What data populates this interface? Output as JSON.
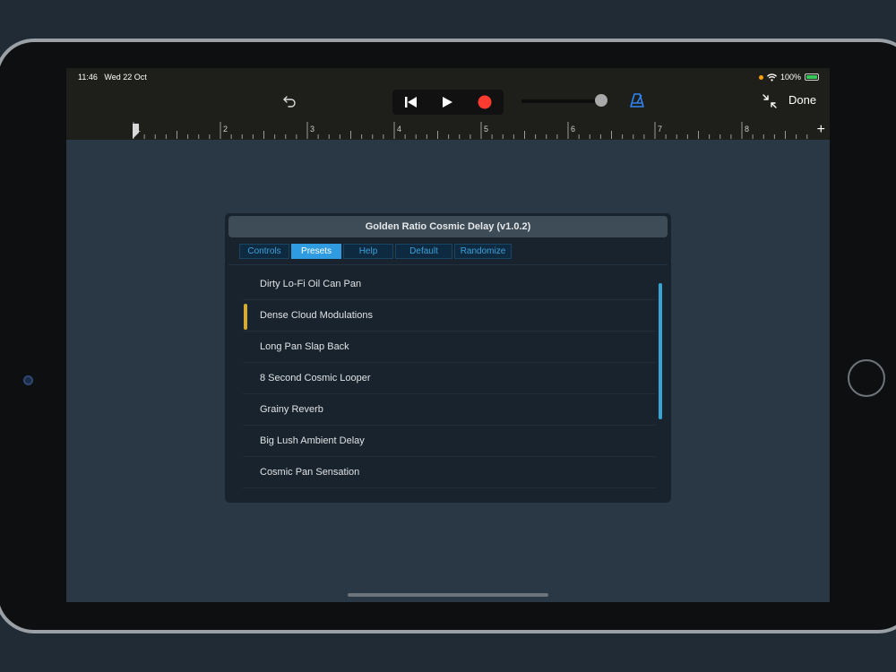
{
  "status_bar": {
    "time": "11:46",
    "date": "Wed 22 Oct",
    "battery": "100%"
  },
  "toolbar": {
    "done_label": "Done",
    "transport_icons": [
      "skip-back-icon",
      "play-icon",
      "record-icon"
    ],
    "record_color": "#ff3b30",
    "metronome_color": "#2f86f6"
  },
  "ruler": {
    "bars": [
      "1",
      "2",
      "3",
      "4",
      "5",
      "6",
      "7",
      "8"
    ],
    "add_label": "+"
  },
  "plugin": {
    "title": "Golden Ratio Cosmic Delay (v1.0.2)",
    "tabs": [
      "Controls",
      "Presets",
      "Help",
      "Default",
      "Randomize"
    ],
    "active_tab": "Presets",
    "presets": [
      "Dirty Lo-Fi Oil Can Pan",
      "Dense Cloud Modulations",
      "Long Pan Slap Back",
      "8 Second Cosmic Looper",
      "Grainy Reverb",
      "Big Lush Ambient Delay",
      "Cosmic Pan Sensation"
    ],
    "selected_preset": "Dense Cloud Modulations",
    "accent_color": "#2f9be0",
    "selection_color": "#d4a934"
  }
}
